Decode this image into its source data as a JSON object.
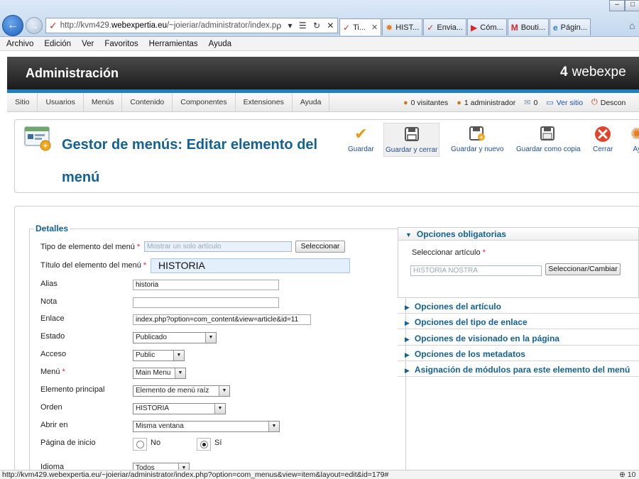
{
  "browser": {
    "url_prefix": "http://kvm429.",
    "url_domain": "webexpertia.eu",
    "url_rest": "/~joieriar/administrator/index.p",
    "addr_controls": "ρ ▾ ☰ ↻ ✕",
    "tabs": [
      {
        "label": "Ti...",
        "icon": "joomla-icon",
        "close": "✕",
        "active": true
      },
      {
        "label": "HIST...",
        "icon": "multi-icon"
      },
      {
        "label": "Envia...",
        "icon": "joomla-icon"
      },
      {
        "label": "Cóm...",
        "icon": "youtube-icon"
      },
      {
        "label": "Bouti...",
        "icon": "gmail-icon"
      },
      {
        "label": "Págin...",
        "icon": "ie-icon"
      }
    ],
    "menu": [
      "Archivo",
      "Edición",
      "Ver",
      "Favoritos",
      "Herramientas",
      "Ayuda"
    ],
    "status_url": "http://kvm429.webexpertia.eu/~joieriar/administrator/index.php?option=com_menus&view=item&layout=edit&id=179#",
    "zoom": "10"
  },
  "header": {
    "title": "Administración",
    "brand": "webexpe",
    "brand_mark": "4"
  },
  "submenu": {
    "items": [
      "Sitio",
      "Usuarios",
      "Menús",
      "Contenido",
      "Componentes",
      "Extensiones",
      "Ayuda"
    ],
    "visitors": "0 visitantes",
    "admins": "1 administrador",
    "messages": "0",
    "view_site": "Ver sitio",
    "logout": "Descon"
  },
  "toolbar": {
    "title_line1": "Gestor de menús: Editar elemento del",
    "title_line2": "menú",
    "save": "Guardar",
    "save_close": "Guardar y cerrar",
    "save_new": "Guardar y nuevo",
    "save_copy": "Guardar como copia",
    "close": "Cerrar",
    "help": "Ay"
  },
  "form": {
    "legend": "Detalles",
    "type_label": "Tipo de elemento del menú",
    "type_value": "Mostrar un solo artículo",
    "select_btn": "Seleccionar",
    "title_label": "Título del elemento del menú",
    "title_value": "HISTORIA",
    "alias_label": "Alias",
    "alias_value": "historia",
    "note_label": "Nota",
    "note_value": "",
    "link_label": "Enlace",
    "link_value": "index.php?option=com_content&view=article&id=11",
    "state_label": "Estado",
    "state_value": "Publicado",
    "access_label": "Acceso",
    "access_value": "Public",
    "menu_label": "Menú",
    "menu_value": "Main Menu",
    "parent_label": "Elemento principal",
    "parent_value": "Elemento de menú raíz",
    "order_label": "Orden",
    "order_value": "HISTORIA",
    "open_label": "Abrir en",
    "open_value": "Misma ventana",
    "home_label": "Página de inicio",
    "home_no": "No",
    "home_yes": "Sí",
    "home_selected": "yes",
    "lang_label": "Idioma",
    "lang_value": "Todos",
    "required_mark": "*"
  },
  "accordion": {
    "required": "Opciones obligatorias",
    "select_article_label": "Seleccionar artículo",
    "article_value": "HISTORIA NOSTRA",
    "change_btn": "Seleccionar/Cambiar",
    "sections": [
      "Opciones del artículo",
      "Opciones del tipo de enlace",
      "Opciones de visionado en la página",
      "Opciones de los metadatos",
      "Asignación de módulos para este elemento del menú"
    ]
  }
}
